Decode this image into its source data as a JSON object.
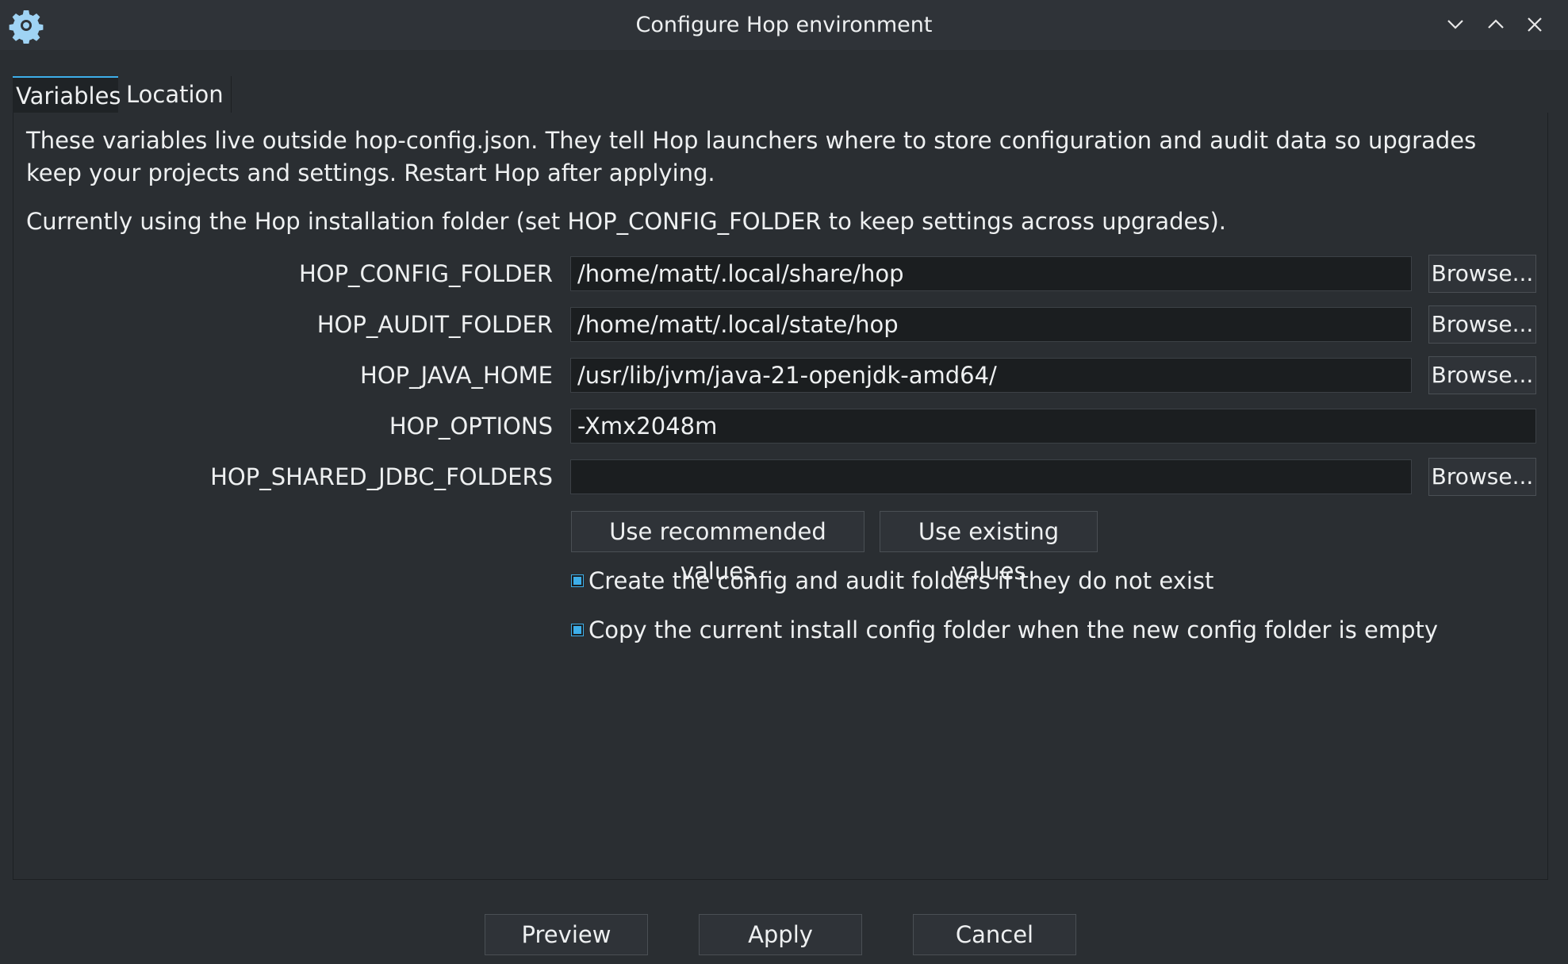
{
  "window": {
    "title": "Configure Hop environment",
    "icons": {
      "app": "gear-icon",
      "minimize": "chevron-down-icon",
      "maximize": "chevron-up-icon",
      "close": "close-icon"
    }
  },
  "tabs": [
    {
      "label": "Variables",
      "active": true
    },
    {
      "label": "Location",
      "active": false
    }
  ],
  "panel": {
    "description": "These variables live outside hop-config.json. They tell Hop launchers where to store configuration and audit data so upgrades keep your projects and settings. Restart Hop after applying.",
    "status": "Currently using the Hop installation folder (set HOP_CONFIG_FOLDER to keep settings across upgrades).",
    "fields": [
      {
        "label": "HOP_CONFIG_FOLDER",
        "value": "/home/matt/.local/share/hop",
        "browse": "Browse..."
      },
      {
        "label": "HOP_AUDIT_FOLDER",
        "value": "/home/matt/.local/state/hop",
        "browse": "Browse..."
      },
      {
        "label": "HOP_JAVA_HOME",
        "value": "/usr/lib/jvm/java-21-openjdk-amd64/",
        "browse": "Browse..."
      },
      {
        "label": "HOP_OPTIONS",
        "value": "-Xmx2048m"
      },
      {
        "label": "HOP_SHARED_JDBC_FOLDERS",
        "value": "",
        "browse": "Browse..."
      }
    ],
    "buttons": {
      "recommended": "Use recommended values",
      "existing": "Use existing values"
    },
    "checkboxes": [
      {
        "label": "Create the config and audit folders if they do not exist",
        "checked": true
      },
      {
        "label": "Copy the current install config folder when the new config folder is empty",
        "checked": true
      }
    ]
  },
  "footer": {
    "preview": "Preview",
    "apply": "Apply",
    "cancel": "Cancel"
  },
  "colors": {
    "background": "#2a2e32",
    "titlebar": "#2f3338",
    "accent": "#3daee9",
    "text": "#eef0f1",
    "field_background": "#1b1e20"
  }
}
